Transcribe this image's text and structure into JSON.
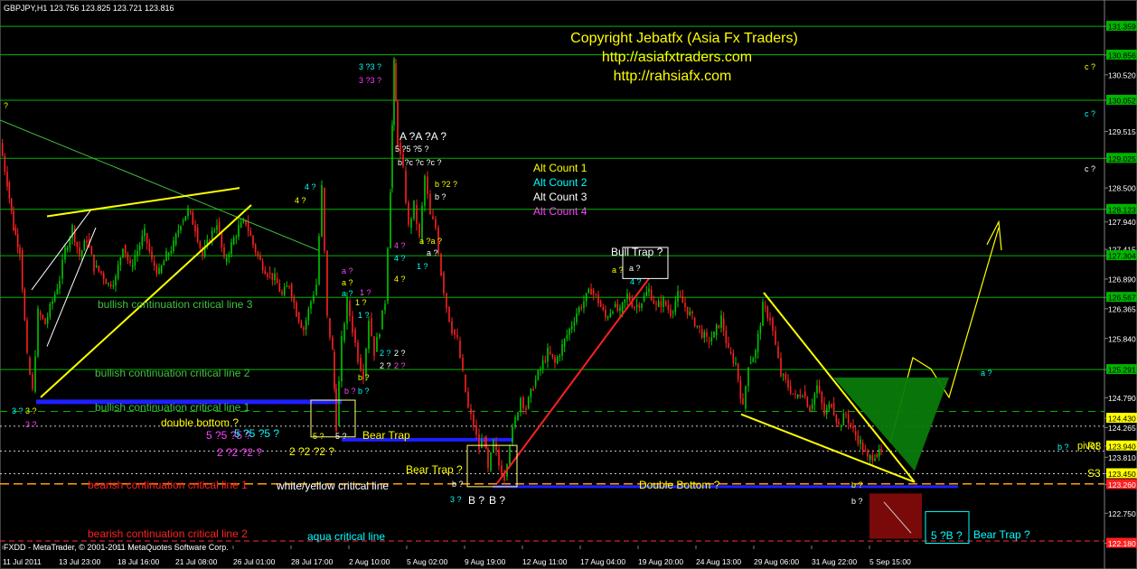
{
  "header": {
    "symbol_line": "GBPJPY,H1  123.756 123.825 123.721 123.816",
    "copyright": "Copyright Jebatfx (Asia Fx Traders)",
    "url1": "http://asiafxtraders.com",
    "url2": "http://rahsiafx.com"
  },
  "footer": {
    "text": "FXDD - MetaTrader, © 2001-2011 MetaQuotes Software Corp."
  },
  "legend": {
    "alt1": "Alt Count 1",
    "alt2": "Alt Count 2",
    "alt3": "Alt Count 3",
    "alt4": "Alt Count 4"
  },
  "colors": {
    "up": "#00c800",
    "down": "#ff2020",
    "grid_line": "#00b400",
    "yellow": "#ffff00",
    "aqua": "#00ffff",
    "magenta": "#ff40ff",
    "blue": "#1e1eff"
  },
  "chart_data": {
    "type": "candlestick",
    "symbol": "GBPJPY",
    "timeframe": "H1",
    "ohlc_last": {
      "open": 123.756,
      "high": 123.825,
      "low": 123.721,
      "close": 123.816
    },
    "ylim": [
      122.18,
      131.6
    ],
    "y_ticks": [
      131.359,
      130.85,
      130.5,
      130.052,
      129.5,
      129.025,
      128.5,
      128.123,
      127.9,
      127.415,
      127.304,
      126.89,
      126.567,
      126.365,
      125.84,
      125.291,
      124.79,
      124.43,
      124.265,
      123.94,
      123.74,
      123.45,
      123.26,
      122.75,
      122.22
    ],
    "y_tick_labels": [
      "131.359",
      "130.856",
      "130.520",
      "130.052",
      "129.515",
      "129.025",
      "128.500",
      "128.123",
      "127.940",
      "127.415",
      "127.304",
      "126.890",
      "126.567",
      "126.365",
      "125.840",
      "125.291",
      "124.790",
      "124.430",
      "124.265",
      "123.940",
      "123.810",
      "123.450",
      "123.260",
      "122.750",
      "122.180"
    ],
    "highlighted_ticks": [
      "131.359",
      "130.856",
      "130.052",
      "129.025",
      "128.123",
      "127.304",
      "126.567",
      "125.291",
      "124.430",
      "123.940",
      "123.450",
      "123.260",
      "122.220"
    ],
    "x_labels": [
      "11 Jul 2011",
      "13 Jul 23:00",
      "18 Jul 16:00",
      "21 Jul 08:00",
      "26 Jul 01:00",
      "28 Jul 17:00",
      "2 Aug 10:00",
      "5 Aug 02:00",
      "9 Aug 19:00",
      "12 Aug 11:00",
      "17 Aug 04:00",
      "19 Aug 20:00",
      "24 Aug 13:00",
      "29 Aug 06:00",
      "31 Aug 22:00",
      "5 Sep 15:00"
    ],
    "path_points": [
      [
        0,
        129.3
      ],
      [
        8,
        128.6
      ],
      [
        15,
        127.8
      ],
      [
        22,
        127.4
      ],
      [
        30,
        125.5
      ],
      [
        36,
        124.9
      ],
      [
        42,
        126.3
      ],
      [
        50,
        126.1
      ],
      [
        58,
        126.5
      ],
      [
        66,
        126.9
      ],
      [
        72,
        127.4
      ],
      [
        80,
        127.8
      ],
      [
        88,
        127.3
      ],
      [
        96,
        127.6
      ],
      [
        104,
        127.1
      ],
      [
        112,
        127.0
      ],
      [
        120,
        126.8
      ],
      [
        128,
        126.9
      ],
      [
        136,
        127.5
      ],
      [
        144,
        127.1
      ],
      [
        152,
        127.4
      ],
      [
        160,
        127.7
      ],
      [
        168,
        127.2
      ],
      [
        176,
        127.0
      ],
      [
        184,
        127.3
      ],
      [
        192,
        127.5
      ],
      [
        200,
        127.9
      ],
      [
        208,
        128.1
      ],
      [
        216,
        127.8
      ],
      [
        224,
        127.3
      ],
      [
        232,
        127.6
      ],
      [
        240,
        127.9
      ],
      [
        248,
        127.2
      ],
      [
        256,
        127.5
      ],
      [
        264,
        127.8
      ],
      [
        272,
        127.9
      ],
      [
        280,
        127.5
      ],
      [
        288,
        127.2
      ],
      [
        296,
        127.0
      ],
      [
        304,
        126.9
      ],
      [
        312,
        126.6
      ],
      [
        320,
        126.8
      ],
      [
        328,
        126.3
      ],
      [
        336,
        126.0
      ],
      [
        344,
        126.5
      ],
      [
        350,
        126.8
      ],
      [
        356,
        128.5
      ],
      [
        362,
        126.2
      ],
      [
        368,
        125.6
      ],
      [
        372,
        124.3
      ],
      [
        378,
        125.8
      ],
      [
        384,
        126.5
      ],
      [
        390,
        126.0
      ],
      [
        396,
        125.5
      ],
      [
        402,
        125.2
      ],
      [
        408,
        126.2
      ],
      [
        414,
        125.6
      ],
      [
        420,
        126.0
      ],
      [
        426,
        126.5
      ],
      [
        432,
        128.5
      ],
      [
        436,
        130.7
      ],
      [
        440,
        129.3
      ],
      [
        446,
        128.8
      ],
      [
        452,
        127.8
      ],
      [
        458,
        128.2
      ],
      [
        464,
        127.6
      ],
      [
        470,
        128.7
      ],
      [
        476,
        128.0
      ],
      [
        482,
        127.8
      ],
      [
        488,
        127.0
      ],
      [
        494,
        126.4
      ],
      [
        500,
        126.0
      ],
      [
        506,
        125.8
      ],
      [
        512,
        125.2
      ],
      [
        518,
        124.6
      ],
      [
        524,
        124.3
      ],
      [
        530,
        123.9
      ],
      [
        536,
        124.1
      ],
      [
        540,
        123.5
      ],
      [
        546,
        124.0
      ],
      [
        552,
        123.6
      ],
      [
        558,
        123.4
      ],
      [
        564,
        124.0
      ],
      [
        570,
        124.4
      ],
      [
        576,
        124.8
      ],
      [
        582,
        124.6
      ],
      [
        590,
        125.0
      ],
      [
        598,
        125.3
      ],
      [
        606,
        125.6
      ],
      [
        614,
        125.4
      ],
      [
        622,
        125.7
      ],
      [
        630,
        126.0
      ],
      [
        638,
        126.3
      ],
      [
        646,
        126.5
      ],
      [
        654,
        126.7
      ],
      [
        662,
        126.5
      ],
      [
        670,
        126.2
      ],
      [
        678,
        126.4
      ],
      [
        686,
        126.3
      ],
      [
        694,
        126.6
      ],
      [
        702,
        126.4
      ],
      [
        710,
        126.5
      ],
      [
        718,
        126.7
      ],
      [
        726,
        126.4
      ],
      [
        734,
        126.5
      ],
      [
        742,
        126.3
      ],
      [
        750,
        126.6
      ],
      [
        758,
        126.4
      ],
      [
        766,
        126.2
      ],
      [
        774,
        126.0
      ],
      [
        782,
        125.8
      ],
      [
        790,
        125.9
      ],
      [
        798,
        126.2
      ],
      [
        806,
        125.6
      ],
      [
        814,
        125.4
      ],
      [
        822,
        124.6
      ],
      [
        828,
        125.4
      ],
      [
        836,
        125.6
      ],
      [
        844,
        126.4
      ],
      [
        852,
        126.2
      ],
      [
        858,
        125.7
      ],
      [
        864,
        125.2
      ],
      [
        872,
        125.0
      ],
      [
        880,
        124.8
      ],
      [
        888,
        124.9
      ],
      [
        896,
        124.6
      ],
      [
        904,
        125.0
      ],
      [
        912,
        124.5
      ],
      [
        920,
        124.7
      ],
      [
        928,
        124.3
      ],
      [
        936,
        124.5
      ],
      [
        944,
        124.2
      ],
      [
        952,
        124.0
      ],
      [
        960,
        123.7
      ],
      [
        968,
        123.8
      ],
      [
        975,
        123.8
      ]
    ]
  },
  "lines": {
    "bull3": "bullish continuation critical line 3",
    "bull2": "bullish continuation critical line 2",
    "bull1": "bullish continuation critical line 1",
    "double_bottom_q": "double bottom ?",
    "bear_trap1": "Bear Trap",
    "bear_trap2": "Bear Trap ?",
    "bear_crit1": "bearish continuation critical line 1",
    "wy_crit": "white/yellow critical line",
    "double_bottom2": "Double Bottom ?",
    "bear_crit2": "bearish continuation critical line 2",
    "aqua_crit": "aqua critical line",
    "bull_trap": "Bull Trap ?",
    "bear_trap3": "Bear Trap ?",
    "r3": "R3",
    "pivot": "pivot",
    "s3": "S3"
  },
  "wave_labels": {
    "c_q": "c ?",
    "a_q": "a ?",
    "b_q": "b ?",
    "q": "?",
    "three_q": "3 ?",
    "four_q": "4 ?",
    "two_q": "2 ?",
    "one_q": "1 ?",
    "five_q": "5 ?",
    "A_q": "A ?",
    "B_q": "B ?",
    "top_33": "3 ?3 ?",
    "A_cluster": "A ?A ?A ?",
    "five_cluster": "5 ?5 ?5 ?",
    "bc_cluster": "b ?c ?c ?c ?",
    "b2_cluster": "b ?2 ?",
    "aa_cluster": "a ?a ?",
    "five_cluster2": "5 ?5 ?5 ?",
    "two_cluster": "2 ?2 ?2 ?",
    "five_b_box": "5 ?B ?"
  }
}
